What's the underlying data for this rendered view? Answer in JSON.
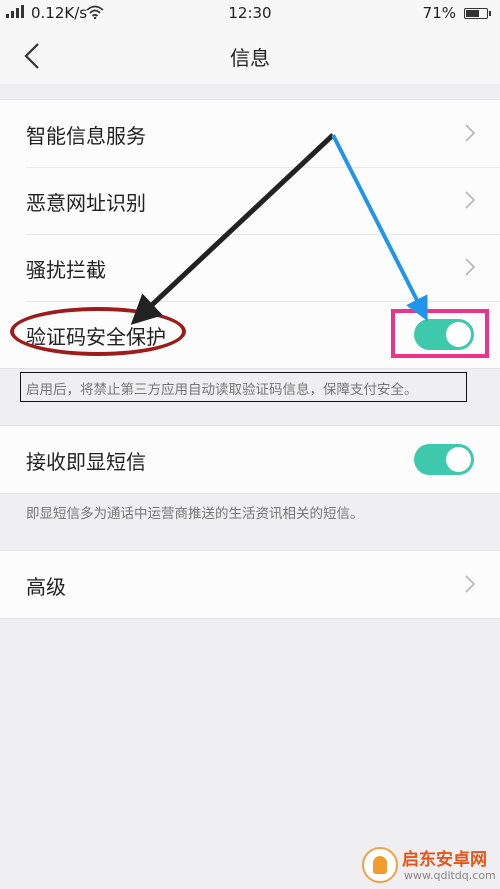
{
  "status_bar": {
    "network_speed": "0.12K/s",
    "time": "12:30",
    "battery_percent": "71%",
    "battery_level": 0.71
  },
  "header": {
    "title": "信息"
  },
  "groups": [
    {
      "rows": [
        {
          "label": "智能信息服务",
          "control": "chevron"
        },
        {
          "label": "恶意网址识别",
          "control": "chevron"
        },
        {
          "label": "骚扰拦截",
          "control": "chevron"
        },
        {
          "label": "验证码安全保护",
          "control": "toggle",
          "on": true
        }
      ],
      "hint": "启用后，将禁止第三方应用自动读取验证码信息，保障支付安全。"
    },
    {
      "rows": [
        {
          "label": "接收即显短信",
          "control": "toggle",
          "on": true
        }
      ],
      "hint": "即显短信多为通话中运营商推送的生活资讯相关的短信。"
    },
    {
      "rows": [
        {
          "label": "高级",
          "control": "chevron"
        }
      ]
    }
  ],
  "colors": {
    "toggle_on": "#3ec9ad",
    "annotation_ellipse": "#9c1b1b",
    "annotation_highlight": "#e8358a",
    "arrow_black": "#222222",
    "arrow_blue": "#2196e8"
  },
  "watermark": {
    "name": "启东安卓网",
    "url": "www.qdltdq.com"
  }
}
